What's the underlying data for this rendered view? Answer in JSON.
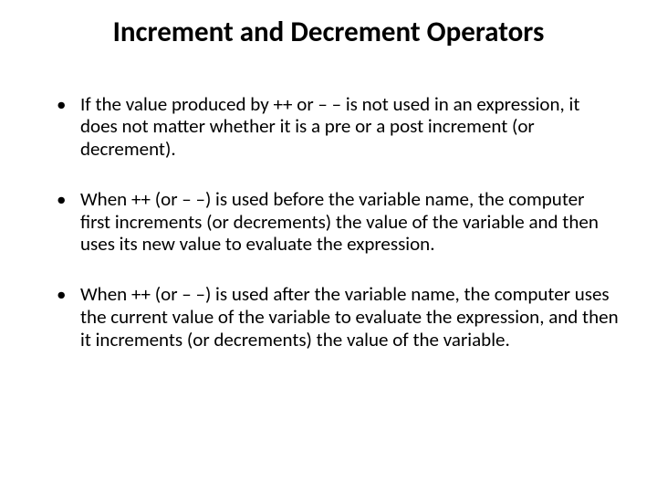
{
  "slide": {
    "title": "Increment and Decrement Operators",
    "bullets": [
      "If the value produced by ++ or – – is not used in an expression, it does not matter whether it is a pre or a post increment (or decrement).",
      "When ++ (or  – –) is used before the variable name, the computer first increments (or decrements) the value of the variable and then uses its new value to evaluate the expression.",
      " When ++ (or  – –) is used after the variable name, the computer uses the current value of the variable to evaluate the expression, and then it increments (or decrements) the value of the variable."
    ]
  }
}
